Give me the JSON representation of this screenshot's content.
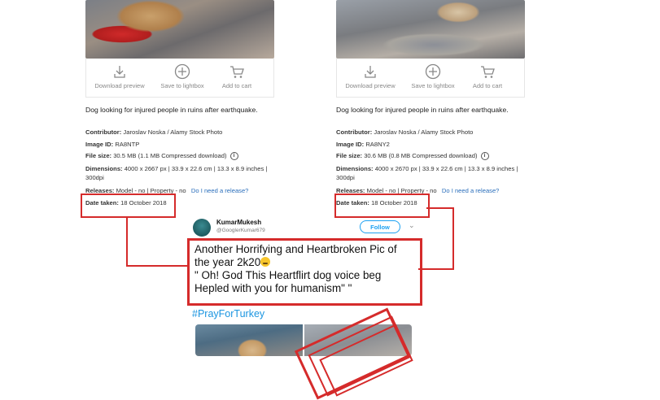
{
  "cards": [
    {
      "actions": {
        "download": "Download preview",
        "lightbox": "Save to lightbox",
        "cart": "Add to cart"
      },
      "description": "Dog looking for injured people in ruins after earthquake.",
      "contributor_label": "Contributor:",
      "contributor": "Jaroslav Noska / Alamy Stock Photo",
      "image_id_label": "Image ID:",
      "image_id": "RA8NTP",
      "file_size_label": "File size:",
      "file_size": "30.5 MB (1.1 MB Compressed download)",
      "dimensions_label": "Dimensions:",
      "dimensions": "4000 x 2667 px | 33.9 x 22.6 cm | 13.3 x 8.9 inches | 300dpi",
      "releases_label": "Releases:",
      "releases": "Model - no | Property - no",
      "release_link": "Do I need a release?",
      "date_label": "Date taken:",
      "date": "18 October 2018"
    },
    {
      "actions": {
        "download": "Download preview",
        "lightbox": "Save to lightbox",
        "cart": "Add to cart"
      },
      "description": "Dog looking for injured people in ruins after earthquake.",
      "contributor_label": "Contributor:",
      "contributor": "Jaroslav Noska / Alamy Stock Photo",
      "image_id_label": "Image ID:",
      "image_id": "RA8NY2",
      "file_size_label": "File size:",
      "file_size": "30.6 MB (0.8 MB Compressed download)",
      "dimensions_label": "Dimensions:",
      "dimensions": "4000 x 2670 px | 33.9 x 22.6 cm | 13.3 x 8.9 inches | 300dpi",
      "releases_label": "Releases:",
      "releases": "Model - no | Property - no",
      "release_link": "Do I need a release?",
      "date_label": "Date taken:",
      "date": "18 October 2018"
    }
  ],
  "tweet": {
    "name": "KumarMukesh",
    "handle": "@GooglerKumar679",
    "follow_label": "Follow",
    "text_line1": "Another Horrifying and Heartbroken Pic of",
    "text_line2": "the year 2k20",
    "text_line3": "\" Oh! God This Heartflirt dog voice  beg",
    "text_line4": "Hepled with you for humanism\" \"",
    "hashtag": "#PrayForTurkey"
  },
  "colors": {
    "highlight": "#d52b2b",
    "link": "#2a6ebb",
    "twitter_blue": "#1da1f2"
  }
}
